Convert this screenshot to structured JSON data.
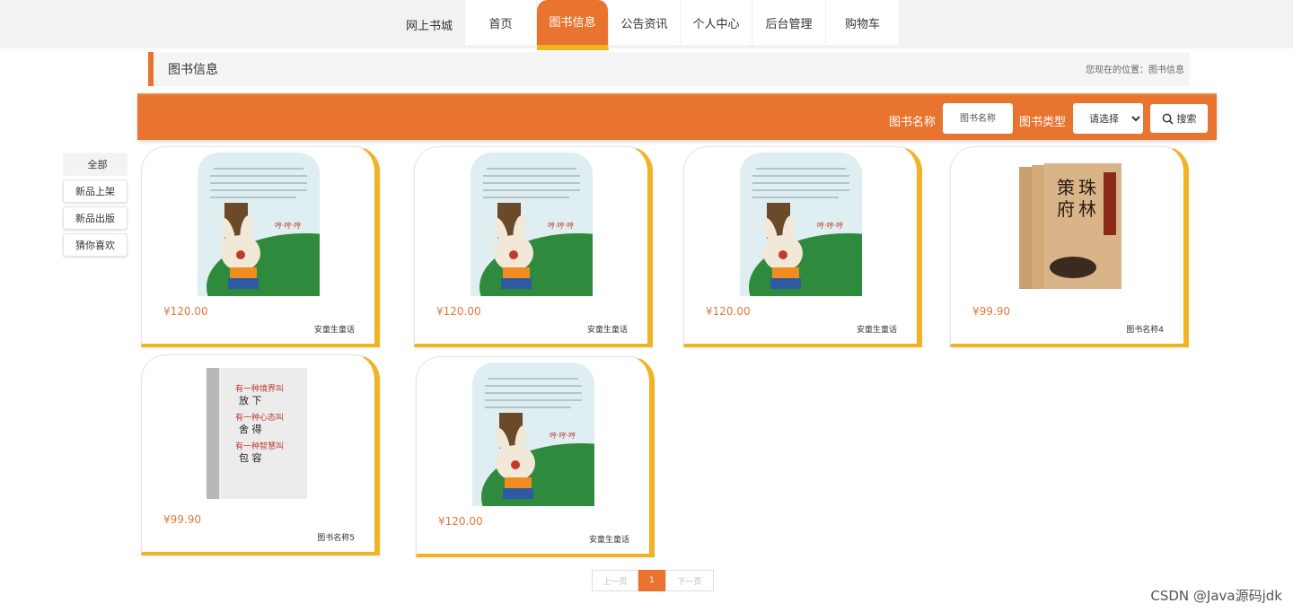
{
  "header": {
    "brand": "网上书城",
    "nav": [
      {
        "label": "首页",
        "active": false
      },
      {
        "label": "图书信息",
        "active": true
      },
      {
        "label": "公告资讯",
        "active": false
      },
      {
        "label": "个人中心",
        "active": false
      },
      {
        "label": "后台管理",
        "active": false
      },
      {
        "label": "购物车",
        "active": false
      }
    ]
  },
  "breadcrumb": {
    "title": "图书信息",
    "location": "您现在的位置：图书信息"
  },
  "search": {
    "name_label": "图书名称",
    "name_placeholder": "图书名称",
    "type_label": "图书类型",
    "type_selected": "请选择",
    "button_label": "搜索"
  },
  "sidebar": {
    "items": [
      {
        "label": "全部",
        "active": true
      },
      {
        "label": "新品上架",
        "active": false
      },
      {
        "label": "新品出版",
        "active": false
      },
      {
        "label": "猜你喜欢",
        "active": false
      }
    ]
  },
  "books": [
    {
      "price": "¥120.00",
      "name": "安童生童话",
      "cover": "rabbit"
    },
    {
      "price": "¥120.00",
      "name": "安童生童话",
      "cover": "rabbit"
    },
    {
      "price": "¥120.00",
      "name": "安童生童话",
      "cover": "rabbit"
    },
    {
      "price": "¥99.90",
      "name": "图书名称4",
      "cover": "boxset"
    },
    {
      "price": "¥99.90",
      "name": "图书名称5",
      "cover": "whitebook"
    },
    {
      "price": "¥120.00",
      "name": "安童生童话",
      "cover": "rabbit"
    }
  ],
  "pagination": {
    "prev_label": "上一页",
    "current": "1",
    "next_label": "下一页"
  },
  "covers": {
    "boxset_title": "策府珠林",
    "whitebook_lines": [
      "有一种境界叫",
      "放下",
      "有一种心态叫",
      "舍得",
      "有一种智慧叫",
      "包容"
    ]
  },
  "watermark": "CSDN @Java源码jdk",
  "colors": {
    "accent": "#e8742f",
    "gold": "#f0b323"
  }
}
